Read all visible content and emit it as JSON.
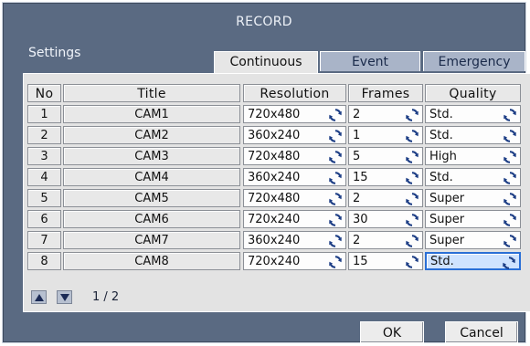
{
  "window": {
    "title": "RECORD"
  },
  "section_label": "Settings",
  "tabs": [
    {
      "label": "Continuous",
      "active": true
    },
    {
      "label": "Event",
      "active": false
    },
    {
      "label": "Emergency",
      "active": false
    }
  ],
  "table": {
    "headers": {
      "no": "No",
      "title": "Title",
      "resolution": "Resolution",
      "frames": "Frames",
      "quality": "Quality"
    },
    "rows": [
      {
        "no": "1",
        "title": "CAM1",
        "resolution": "720x480",
        "frames": "2",
        "quality": "Std."
      },
      {
        "no": "2",
        "title": "CAM2",
        "resolution": "360x240",
        "frames": "1",
        "quality": "Std."
      },
      {
        "no": "3",
        "title": "CAM3",
        "resolution": "720x480",
        "frames": "5",
        "quality": "High"
      },
      {
        "no": "4",
        "title": "CAM4",
        "resolution": "360x240",
        "frames": "15",
        "quality": "Std."
      },
      {
        "no": "5",
        "title": "CAM5",
        "resolution": "720x480",
        "frames": "2",
        "quality": "Super"
      },
      {
        "no": "6",
        "title": "CAM6",
        "resolution": "720x240",
        "frames": "30",
        "quality": "Super"
      },
      {
        "no": "7",
        "title": "CAM7",
        "resolution": "360x240",
        "frames": "2",
        "quality": "Super"
      },
      {
        "no": "8",
        "title": "CAM8",
        "resolution": "720x240",
        "frames": "15",
        "quality": "Std."
      }
    ],
    "selected_cell": {
      "row": 8,
      "column": "quality"
    }
  },
  "pager": {
    "indicator": "1 / 2",
    "up_icon": "triangle-up-icon",
    "down_icon": "triangle-down-icon"
  },
  "buttons": {
    "ok": "OK",
    "cancel": "Cancel"
  },
  "colors": {
    "window_bg": "#5a6a82",
    "panel_bg": "#e3e3e3",
    "selection": "#2a6fd6"
  },
  "icons": {
    "spin": "rotate-arrows-icon"
  }
}
